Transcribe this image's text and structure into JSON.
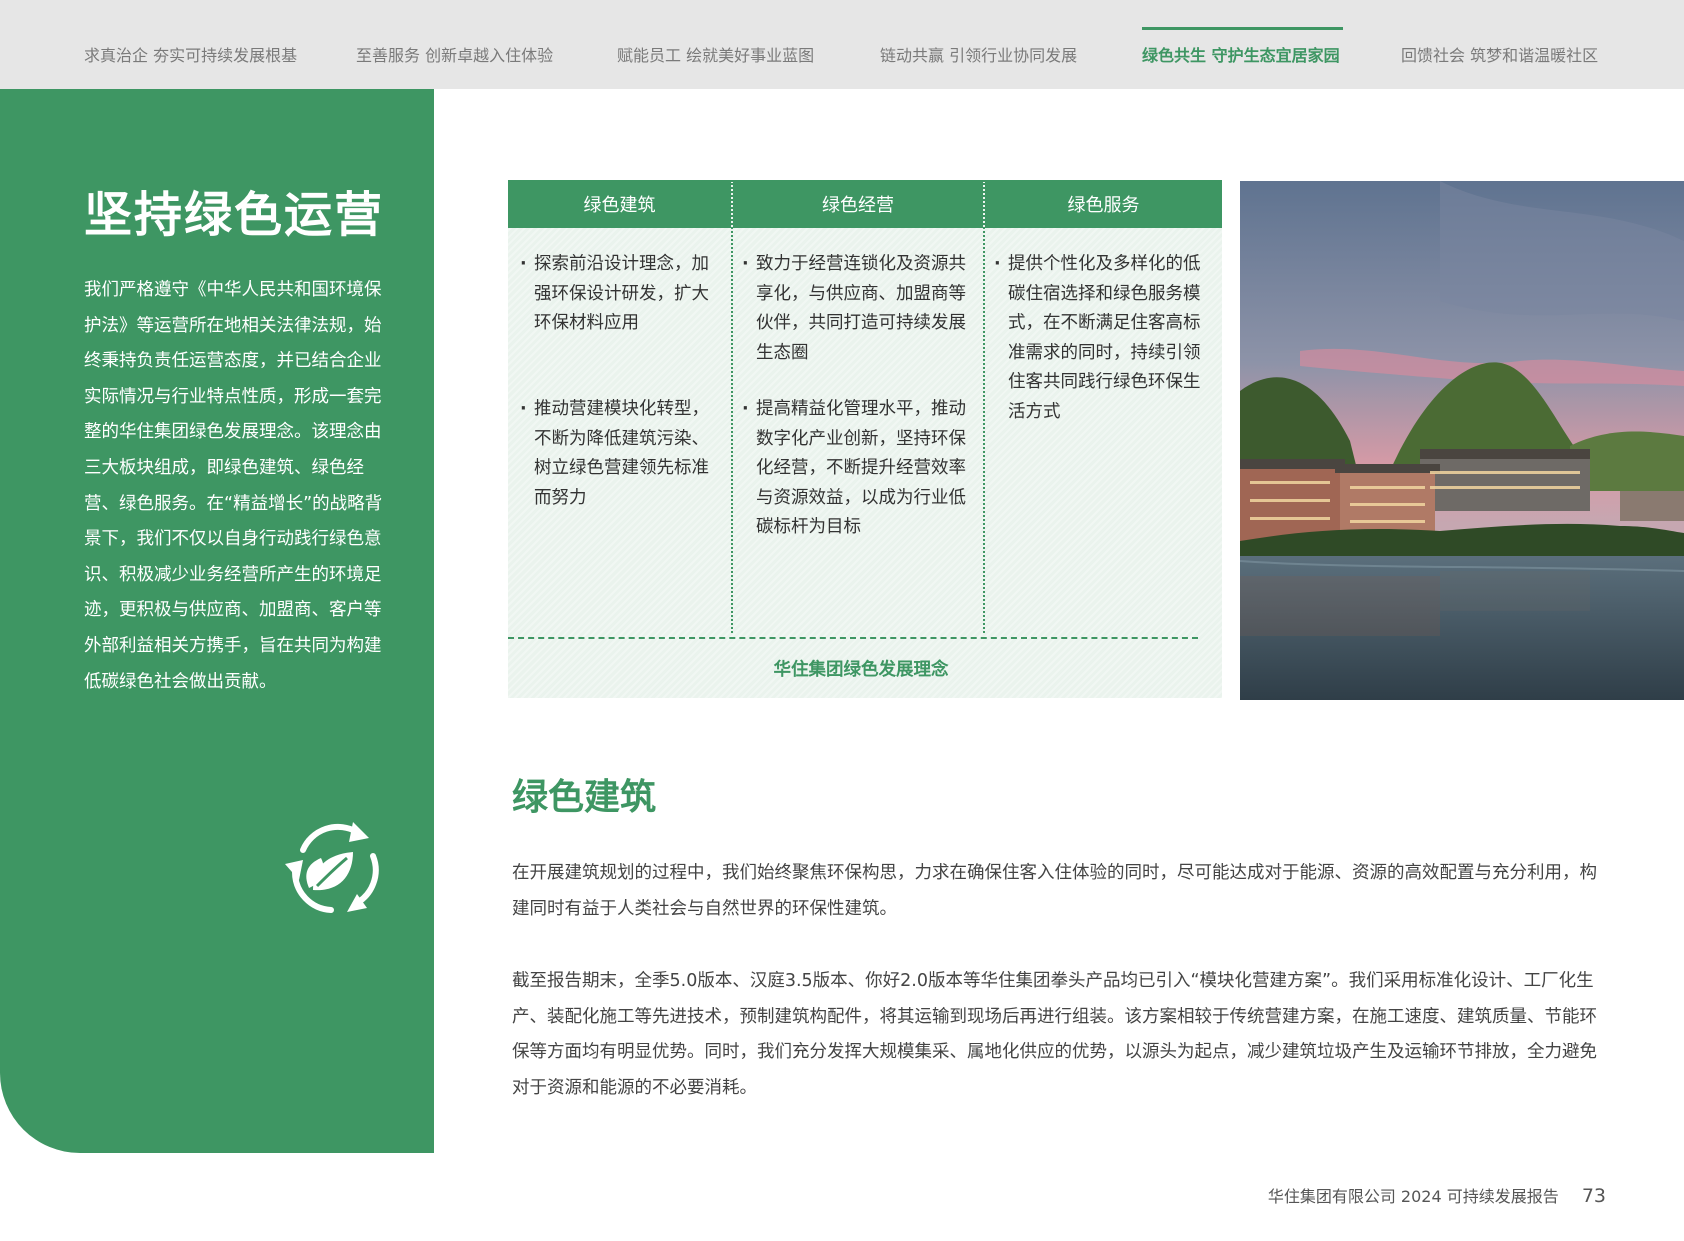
{
  "nav": {
    "items": [
      {
        "label": "求真治企 夯实可持续发展根基",
        "active": false
      },
      {
        "label": "至善服务 创新卓越入住体验",
        "active": false
      },
      {
        "label": "赋能员工 绘就美好事业蓝图",
        "active": false
      },
      {
        "label": "链动共赢 引领行业协同发展",
        "active": false
      },
      {
        "label": "绿色共生 守护生态宜居家园",
        "active": true
      },
      {
        "label": "回馈社会 筑梦和谐温暖社区",
        "active": false
      }
    ]
  },
  "left": {
    "title": "坚持绿色运营",
    "body": "我们严格遵守《中华人民共和国环境保护法》等运营所在地相关法律法规，始终秉持负责任运营态度，并已结合企业实际情况与行业特点性质，形成一套完整的华住集团绿色发展理念。该理念由三大板块组成，即绿色建筑、绿色经营、绿色服务。在“精益增长”的战略背景下，我们不仅以自身行动践行绿色意识、积极减少业务经营所产生的环境足迹，更积极与供应商、加盟商、客户等外部利益相关方携手，旨在共同为构建低碳绿色社会做出贡献。",
    "icon": "recycle-leaf-icon"
  },
  "pillars": {
    "columns": [
      {
        "title": "绿色建筑",
        "items": [
          "探索前沿设计理念，加强环保设计研发，扩大环保材料应用",
          "推动营建模块化转型，不断为降低建筑污染、树立绿色营建领先标准而努力"
        ]
      },
      {
        "title": "绿色经营",
        "items": [
          "致力于经营连锁化及资源共享化，与供应商、加盟商等伙伴，共同打造可持续发展生态圈",
          "提高精益化管理水平，推动数字化产业创新，坚持环保化经营，不断提升经营效率与资源效益，以成为行业低碳标杆为目标"
        ]
      },
      {
        "title": "绿色服务",
        "items": [
          "提供个性化及多样化的低碳住宿选择和绿色服务模式，在不断满足住客高标准需求的同时，持续引领住客共同践行绿色环保生活方式"
        ]
      }
    ],
    "caption": "华住集团绿色发展理念"
  },
  "section": {
    "title": "绿色建筑",
    "paragraphs": [
      "在开展建筑规划的过程中，我们始终聚焦环保构思，力求在确保住客入住体验的同时，尽可能达成对于能源、资源的高效配置与充分利用，构建同时有益于人类社会与自然世界的环保性建筑。",
      "截至报告期末，全季5.0版本、汉庭3.5版本、你好2.0版本等华住集团拳头产品均已引入“模块化营建方案”。我们采用标准化设计、工厂化生产、装配化施工等先进技术，预制建筑构配件，将其运输到现场后再进行组装。该方案相较于传统营建方案，在施工速度、建筑质量、节能环保等方面均有明显优势。同时，我们充分发挥大规模集采、属地化供应的优势，以源头为起点，减少建筑垃圾产生及运输环节排放，全力避免对于资源和能源的不必要消耗。"
    ]
  },
  "footer": {
    "report": "华住集团有限公司 2024 可持续发展报告",
    "page": "73"
  },
  "colors": {
    "brand_green": "#3e9663",
    "nav_bg": "#e6e6e6",
    "panel_tint": "#eaf3ed"
  }
}
